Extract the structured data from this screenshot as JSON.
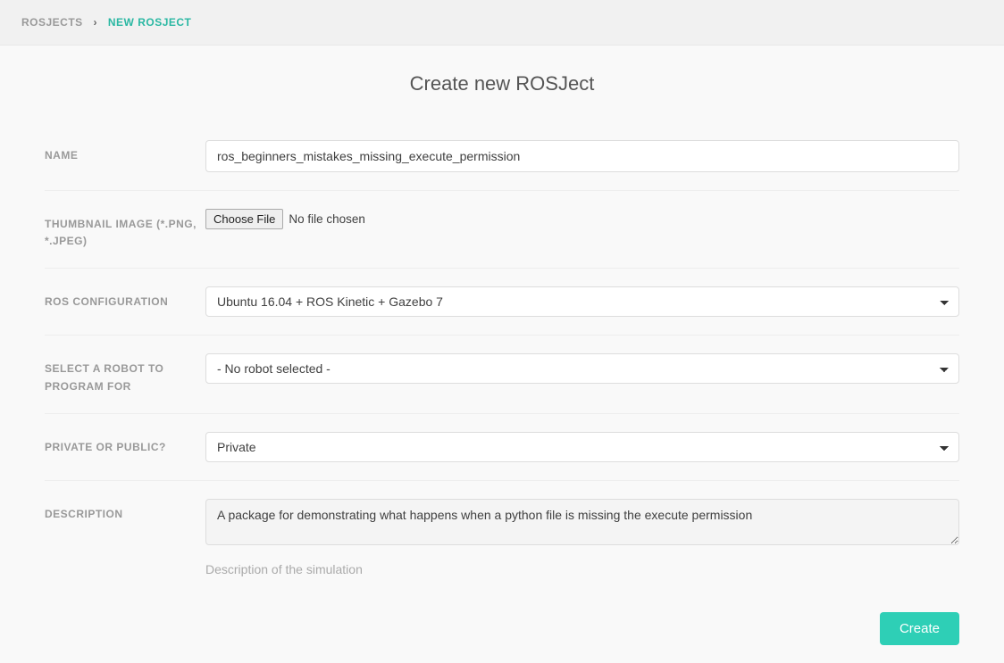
{
  "breadcrumb": {
    "items": [
      "ROSJECTS",
      "NEW ROSJECT"
    ],
    "active_index": 1
  },
  "page_title": "Create new ROSJect",
  "form": {
    "name": {
      "label": "NAME",
      "value": "ros_beginners_mistakes_missing_execute_permission"
    },
    "thumbnail": {
      "label": "THUMBNAIL IMAGE (*.PNG, *.JPEG)",
      "button_label": "Choose File",
      "status": "No file chosen"
    },
    "ros_config": {
      "label": "ROS CONFIGURATION",
      "value": "Ubuntu 16.04 + ROS Kinetic + Gazebo 7"
    },
    "robot": {
      "label": "SELECT A ROBOT TO PROGRAM FOR",
      "value": "- No robot selected -"
    },
    "visibility": {
      "label": "PRIVATE OR PUBLIC?",
      "value": "Private"
    },
    "description": {
      "label": "DESCRIPTION",
      "value": "A package for demonstrating what happens when a python file is missing the execute permission",
      "help": "Description of the simulation"
    }
  },
  "actions": {
    "create_label": "Create"
  }
}
